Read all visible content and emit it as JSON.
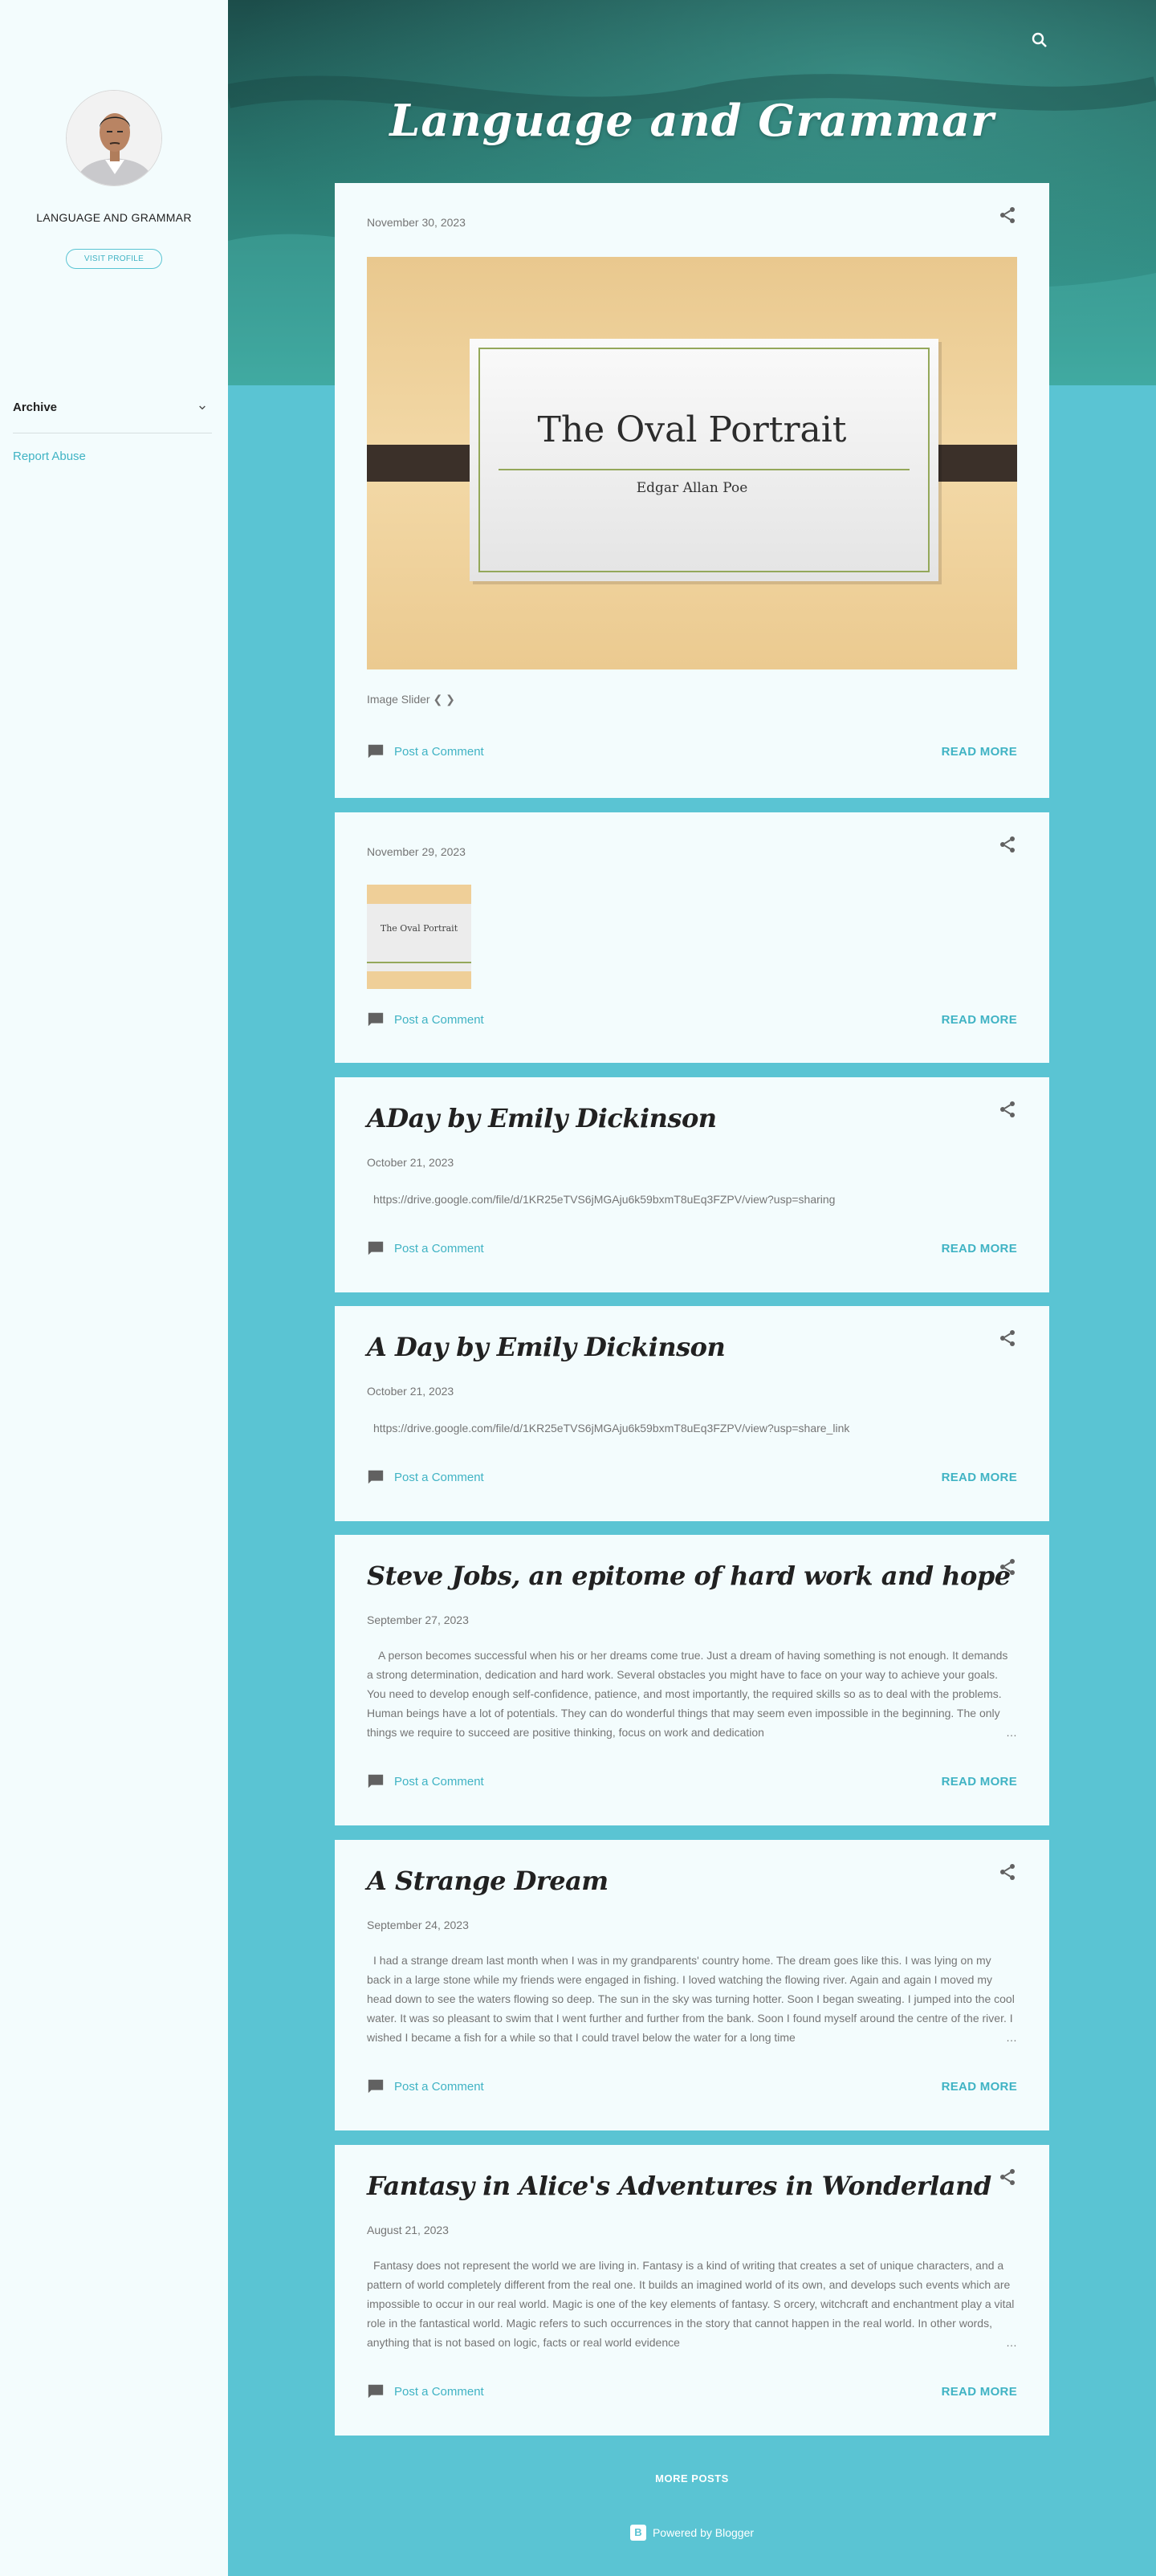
{
  "sidebar": {
    "profile_name": "LANGUAGE AND GRAMMAR",
    "visit_profile": "VISIT PROFILE",
    "archive_label": "Archive",
    "report_abuse": "Report Abuse"
  },
  "header": {
    "blog_title": "Language and Grammar",
    "search_icon": "search-icon"
  },
  "posts": [
    {
      "date": "November 30, 2023",
      "slide_title": "The Oval Portrait",
      "slide_subtitle": "Edgar Allan Poe",
      "slider_text": "Image Slider ❮ ❯",
      "comment": "Post a Comment",
      "read_more": "READ MORE"
    },
    {
      "date": "November 29, 2023",
      "thumb_title": "The Oval Portrait",
      "comment": "Post a Comment",
      "read_more": "READ MORE"
    },
    {
      "title": "ADay by Emily Dickinson",
      "date": "October 21, 2023",
      "snippet": "https://drive.google.com/file/d/1KR25eTVS6jMGAju6k59bxmT8uEq3FZPV/view?usp=sharing",
      "comment": "Post a Comment",
      "read_more": "READ MORE"
    },
    {
      "title": "A Day by Emily Dickinson",
      "date": "October 21, 2023",
      "snippet": "https://drive.google.com/file/d/1KR25eTVS6jMGAju6k59bxmT8uEq3FZPV/view?usp=share_link",
      "comment": "Post a Comment",
      "read_more": "READ MORE"
    },
    {
      "title": "Steve Jobs, an epitome of hard work and hope",
      "date": "September 27, 2023",
      "snippet": "A person becomes successful when his or her dreams come true. Just a dream of having something is not enough. It demands a strong determination, dedication and hard work. Several obstacles you might have to face on your way to achieve your goals. You need to develop enough self-confidence, patience, and most importantly, the required skills so as to deal with the problems. Human beings have a lot of potentials. They can do wonderful things that may seem even impossible in the beginning. The only things we require to succeed are positive thinking, focus on work and dedication",
      "comment": "Post a Comment",
      "read_more": "READ MORE"
    },
    {
      "title": "A Strange Dream",
      "date": "September 24, 2023",
      "snippet": "I had a strange dream last month when I was in my grandparents' country home. The dream goes like this. I was lying on my back in a large stone while my friends were engaged in fishing. I loved watching the flowing river. Again and again I moved my head down to see the waters flowing so deep. The sun in the sky was turning hotter. Soon I began sweating. I jumped into the cool water. It was so pleasant to swim that I went further and further from the bank. Soon I found myself around the centre of the river. I wished I became a fish for a while so that I could travel below the water for a long time",
      "comment": "Post a Comment",
      "read_more": "READ MORE"
    },
    {
      "title": "Fantasy in Alice's Adventures in Wonderland",
      "date": "August 21, 2023",
      "snippet": "Fantasy does not represent the world we are living in. Fantasy is a kind of writing that creates a set of unique characters, and a pattern of world completely different from the real one. It builds an imagined world of its own, and develops such events which are impossible to occur in our real world. Magic is one of the key elements of fantasy. S orcery, witchcraft and enchantment play a vital role in the fantastical world. Magic refers to such occurrences in the story that cannot happen in the real world. In other words, anything that is not based on logic, facts or real world evidence",
      "comment": "Post a Comment",
      "read_more": "READ MORE"
    }
  ],
  "ellipsis": "…",
  "footer": {
    "more_posts": "MORE POSTS",
    "powered_by": "Powered by Blogger",
    "blogger_logo": "B"
  },
  "colors": {
    "accent": "#40b3c4",
    "page_bg": "#5ac4d3",
    "card_bg": "#f3fcfd"
  }
}
